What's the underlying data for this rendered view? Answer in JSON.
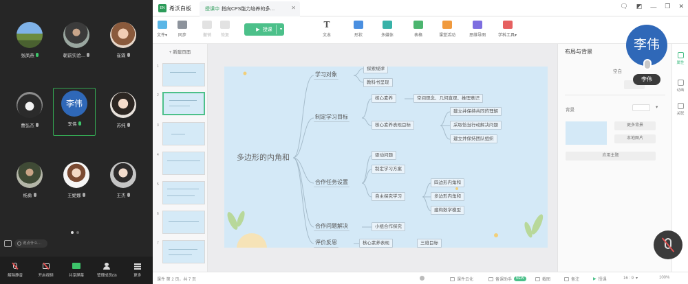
{
  "meeting": {
    "participants": [
      {
        "name": "张凤燕",
        "mic": "on"
      },
      {
        "name": "朝前实验…",
        "mic": "off"
      },
      {
        "name": "崔霖",
        "mic": "off"
      },
      {
        "name": "曹弘杰",
        "mic": "off"
      },
      {
        "name": "李伟",
        "mic": "on",
        "speaking": true,
        "avatar_text": "李伟"
      },
      {
        "name": "苏纯",
        "mic": "off"
      },
      {
        "name": "杨勇",
        "mic": "off"
      },
      {
        "name": "王妮娜",
        "mic": "off"
      },
      {
        "name": "王杰",
        "mic": "off"
      }
    ],
    "chat_placeholder": "说点什么…",
    "toolbar": [
      {
        "label": "解除静音",
        "icon": "mic-muted-icon"
      },
      {
        "label": "开启视频",
        "icon": "video-off-icon"
      },
      {
        "label": "共享屏幕",
        "icon": "screen-share-icon"
      },
      {
        "label": "管理成员(9)",
        "icon": "members-icon"
      },
      {
        "label": "更多",
        "icon": "more-icon"
      }
    ]
  },
  "whiteboard": {
    "app_name": "希沃白板",
    "app_logo_text": "EN",
    "tab": {
      "status": "授课中",
      "title": "指向CPS能力培养的多…"
    },
    "toolbar": {
      "file": "文件",
      "sync": "同步",
      "undo": "撤销",
      "redo": "恢复",
      "start": "授课",
      "tools": [
        "文本",
        "形状",
        "多媒体",
        "表格",
        "课堂活动",
        "思维导图",
        "学科工具"
      ]
    },
    "new_page": "+ 新建页面",
    "slide_numbers": [
      "1",
      "2",
      "3",
      "4",
      "5",
      "6",
      "7"
    ],
    "mindmap": {
      "root": "多边形的内角和",
      "branches": [
        {
          "label": "学习对象",
          "children": [
            "探索规律",
            "教科书呈现"
          ]
        },
        {
          "label": "制定学习目标",
          "children": [
            "核心素养",
            "核心素养表现目标"
          ]
        },
        {
          "label": "合作任务设置",
          "children": [
            "驱动问题",
            "制定学习方案",
            "自主探究学习"
          ]
        },
        {
          "label": "合作问题解决",
          "children": [
            "小组合作探究"
          ]
        },
        {
          "label": "评价反思",
          "children": [
            "核心素养表现"
          ]
        }
      ],
      "level3": {
        "core_literacy": "空间观念、几何直观、推理意识",
        "goals": [
          "建立并保持共同的理解",
          "采取恰当行动解决问题",
          "建立并保持团队组织"
        ],
        "explore": [
          "四边形内角和",
          "多边形内角和",
          "建构数学模型"
        ],
        "eval": "三维目标"
      }
    },
    "props": {
      "title": "布局与背景",
      "blank": "空白",
      "bg_label": "背景",
      "more_bg": "更多背景",
      "local_image": "本地图片",
      "apply_theme": "应用主题"
    },
    "right_nav": [
      "属性",
      "动画",
      "关联"
    ],
    "status": {
      "page": "课件 第 2 页，共 7 页",
      "courseware": "课件云化",
      "assistant": "备课助手",
      "badge": "NEW",
      "screenshot": "截图",
      "notes": "备注",
      "teach": "授课",
      "ratio": "16 : 9",
      "zoom": "100%"
    }
  },
  "floating_cam": {
    "avatar_text": "李伟",
    "name": "李伟"
  },
  "colors": {
    "accent": "#4cc08a",
    "speaker_border": "#34a853",
    "avatar_blue": "#2f68b8"
  }
}
